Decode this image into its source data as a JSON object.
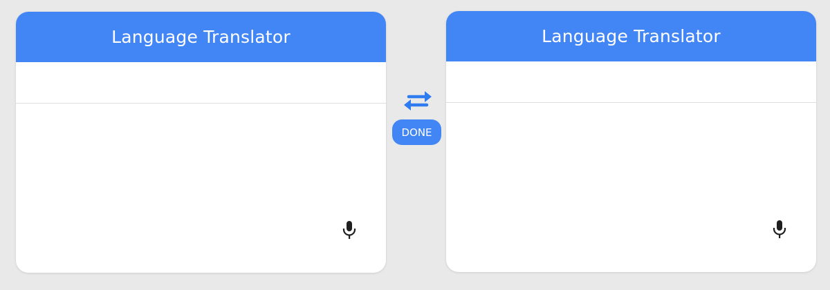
{
  "source_panel": {
    "title": "Language Translator",
    "language_value": "",
    "text_value": "",
    "mic_icon": "microphone-icon"
  },
  "target_panel": {
    "title": "Language Translator",
    "language_value": "",
    "text_value": "",
    "mic_icon": "microphone-icon"
  },
  "controls": {
    "swap_icon": "swap-arrows-icon",
    "done_label": "DONE"
  },
  "colors": {
    "accent": "#4285f4",
    "background": "#e9e9e9",
    "panel": "#ffffff",
    "icon": "#1f1f1f"
  }
}
